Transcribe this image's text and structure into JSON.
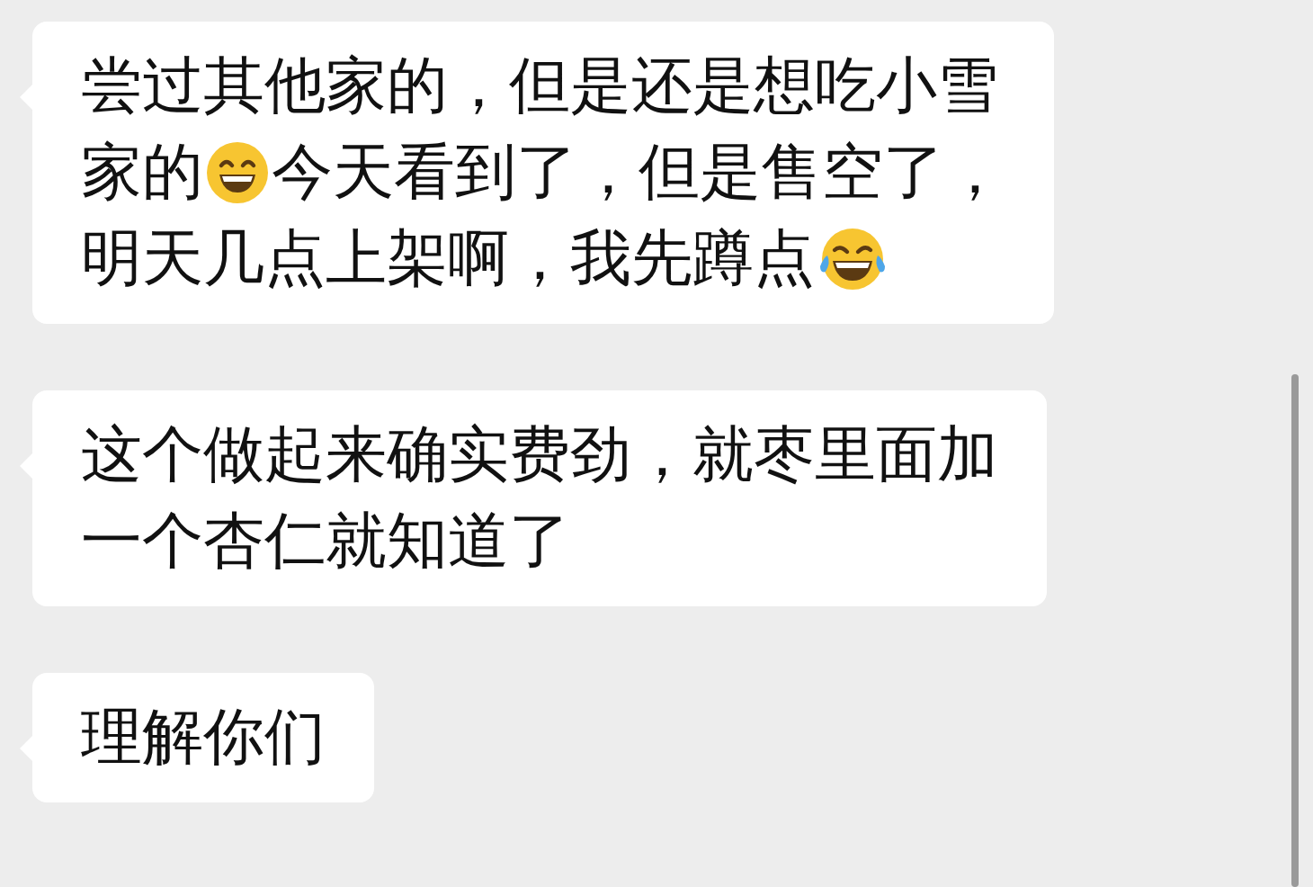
{
  "messages": [
    {
      "lines": [
        [
          {
            "kind": "text",
            "text": "尝过其他家的，但是还是想吃小雪"
          }
        ],
        [
          {
            "kind": "text",
            "text": "家的"
          },
          {
            "kind": "grin"
          },
          {
            "kind": "text",
            "text": "今天看到了，但是售空了，"
          }
        ],
        [
          {
            "kind": "text",
            "text": "明天几点上架啊，我先蹲点"
          },
          {
            "kind": "tears"
          }
        ]
      ]
    },
    {
      "lines": [
        [
          {
            "kind": "text",
            "text": "这个做起来确实费劲，就枣里面加"
          }
        ],
        [
          {
            "kind": "text",
            "text": "一个杏仁就知道了"
          }
        ]
      ]
    },
    {
      "lines": [
        [
          {
            "kind": "text",
            "text": "理解你们"
          }
        ]
      ]
    }
  ]
}
